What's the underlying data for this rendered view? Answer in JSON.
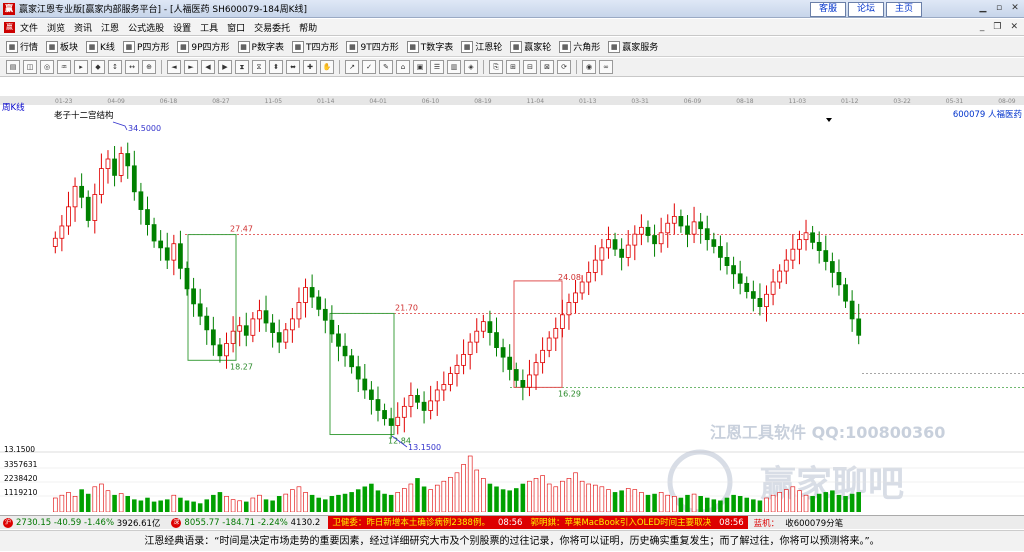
{
  "window": {
    "title": "赢家江恩专业版[赢家内部服务平台] - [人福医药  SH600079-184周K线]",
    "links": [
      "客服",
      "论坛",
      "主页"
    ]
  },
  "menu": [
    "文件",
    "浏览",
    "资讯",
    "江恩",
    "公式选股",
    "设置",
    "工具",
    "窗口",
    "交易委托",
    "帮助"
  ],
  "toolbar1": [
    {
      "icon": "grid-icon",
      "label": "行情"
    },
    {
      "icon": "block-icon",
      "label": "板块"
    },
    {
      "icon": "kline-icon",
      "label": "K线"
    },
    {
      "icon": "p-square-icon",
      "label": "P四方形"
    },
    {
      "icon": "9p-square-icon",
      "label": "9P四方形"
    },
    {
      "icon": "p-number-icon",
      "label": "P数字表"
    },
    {
      "icon": "t-square-icon",
      "label": "T四方形"
    },
    {
      "icon": "9t-square-icon",
      "label": "9T四方形"
    },
    {
      "icon": "t-number-icon",
      "label": "T数字表"
    },
    {
      "icon": "gann-wheel-icon",
      "label": "江恩轮"
    },
    {
      "icon": "winner-wheel-icon",
      "label": "赢家轮"
    },
    {
      "icon": "hexagon-icon",
      "label": "六角形"
    },
    {
      "icon": "dollar-icon",
      "label": "赢家服务"
    }
  ],
  "chart_header": {
    "period": "周K线",
    "indicator": "老子十二宫结构",
    "stock": "600079 人福医药"
  },
  "date_axis": [
    "01-23",
    "04-09",
    "06-18",
    "08-27",
    "11-05",
    "01-14",
    "04-01",
    "06-10",
    "08-19",
    "11-04",
    "01-13",
    "03-31",
    "06-09",
    "08-18",
    "11-03",
    "01-12",
    "03-22",
    "05-31",
    "08-09"
  ],
  "price_labels": {
    "high": "34.5000",
    "low": "13.1500",
    "levels": [
      "27.47",
      "21.70",
      "18.27",
      "12.84",
      "24.08",
      "16.29"
    ]
  },
  "volume_axis": [
    "13.1500",
    "3357631",
    "2238420",
    "1119210"
  ],
  "watermark": {
    "line1": "江恩工具软件  QQ:100800360",
    "line2": "赢家聊吧"
  },
  "status": {
    "index1": {
      "value": "2730.15",
      "change": "-40.59",
      "pct": "-1.46%",
      "amount": "3926.61亿"
    },
    "index2": {
      "value": "8055.77",
      "change": "-184.71",
      "pct": "-2.24%",
      "amount": "4130.2"
    },
    "news": [
      {
        "text": "卫健委：昨日新增本土确诊病例2388例。",
        "time": "08:56"
      },
      {
        "text": "郭明錤：苹果MacBook引入OLED时间主要取决",
        "time": "08:56"
      }
    ],
    "right": "蓝机：",
    "right2": "收600079分笔"
  },
  "footer": "江恩经典语录：“时间是决定市场走势的重要因素，经过详细研究大市及个别股票的过往记录，你将可以证明，历史确实重复发生；而了解过往，你将可以预测将来。”。",
  "chart_data": {
    "type": "candlestick",
    "colors": {
      "up": "#e00000",
      "down": "#008000",
      "volume": "#00a000"
    },
    "ylim": [
      12,
      36
    ],
    "closes": [
      27.2,
      28.1,
      29.5,
      31.0,
      30.2,
      28.5,
      30.4,
      32.3,
      33.0,
      31.8,
      33.4,
      32.5,
      30.6,
      29.3,
      28.2,
      27.0,
      26.5,
      25.6,
      26.8,
      25.0,
      23.5,
      22.4,
      21.5,
      20.5,
      19.4,
      18.6,
      19.5,
      20.4,
      20.8,
      20.1,
      21.3,
      21.9,
      21.0,
      20.3,
      19.6,
      20.5,
      21.3,
      22.5,
      23.6,
      22.9,
      22.0,
      21.2,
      20.2,
      19.3,
      18.6,
      17.8,
      16.9,
      16.1,
      15.4,
      14.6,
      14.0,
      13.5,
      14.1,
      14.9,
      15.7,
      15.2,
      14.6,
      15.3,
      16.1,
      16.5,
      17.3,
      17.9,
      18.7,
      19.6,
      20.4,
      21.1,
      20.3,
      19.2,
      18.5,
      17.6,
      16.8,
      16.3,
      17.2,
      18.1,
      19.0,
      19.9,
      20.6,
      21.6,
      22.5,
      23.2,
      24.0,
      24.7,
      25.6,
      26.5,
      27.1,
      26.4,
      25.8,
      26.7,
      27.5,
      28.0,
      27.4,
      26.8,
      27.6,
      28.3,
      28.8,
      28.1,
      27.5,
      28.4,
      27.9,
      27.1,
      26.6,
      25.8,
      25.2,
      24.6,
      23.9,
      23.3,
      22.8,
      22.2,
      23.1,
      24.0,
      24.8,
      25.6,
      26.4,
      27.1,
      27.6,
      26.9,
      26.3,
      25.5,
      24.7,
      23.8,
      22.6,
      21.3,
      20.1
    ],
    "volumes": [
      0.25,
      0.3,
      0.35,
      0.28,
      0.4,
      0.32,
      0.45,
      0.5,
      0.38,
      0.3,
      0.33,
      0.28,
      0.22,
      0.2,
      0.25,
      0.18,
      0.2,
      0.22,
      0.3,
      0.25,
      0.2,
      0.18,
      0.15,
      0.22,
      0.3,
      0.35,
      0.28,
      0.22,
      0.2,
      0.18,
      0.25,
      0.3,
      0.22,
      0.2,
      0.28,
      0.32,
      0.4,
      0.45,
      0.35,
      0.3,
      0.25,
      0.22,
      0.28,
      0.3,
      0.32,
      0.35,
      0.4,
      0.45,
      0.5,
      0.38,
      0.32,
      0.3,
      0.35,
      0.42,
      0.5,
      0.6,
      0.45,
      0.4,
      0.48,
      0.55,
      0.62,
      0.7,
      0.85,
      1.0,
      0.75,
      0.6,
      0.5,
      0.45,
      0.4,
      0.38,
      0.42,
      0.5,
      0.55,
      0.6,
      0.65,
      0.5,
      0.45,
      0.55,
      0.6,
      0.7,
      0.55,
      0.5,
      0.48,
      0.45,
      0.4,
      0.35,
      0.38,
      0.42,
      0.4,
      0.35,
      0.3,
      0.32,
      0.35,
      0.3,
      0.28,
      0.25,
      0.3,
      0.32,
      0.28,
      0.25,
      0.22,
      0.2,
      0.25,
      0.3,
      0.28,
      0.25,
      0.22,
      0.2,
      0.25,
      0.3,
      0.35,
      0.4,
      0.45,
      0.38,
      0.3,
      0.28,
      0.32,
      0.35,
      0.38,
      0.3,
      0.28,
      0.32,
      0.35
    ]
  }
}
